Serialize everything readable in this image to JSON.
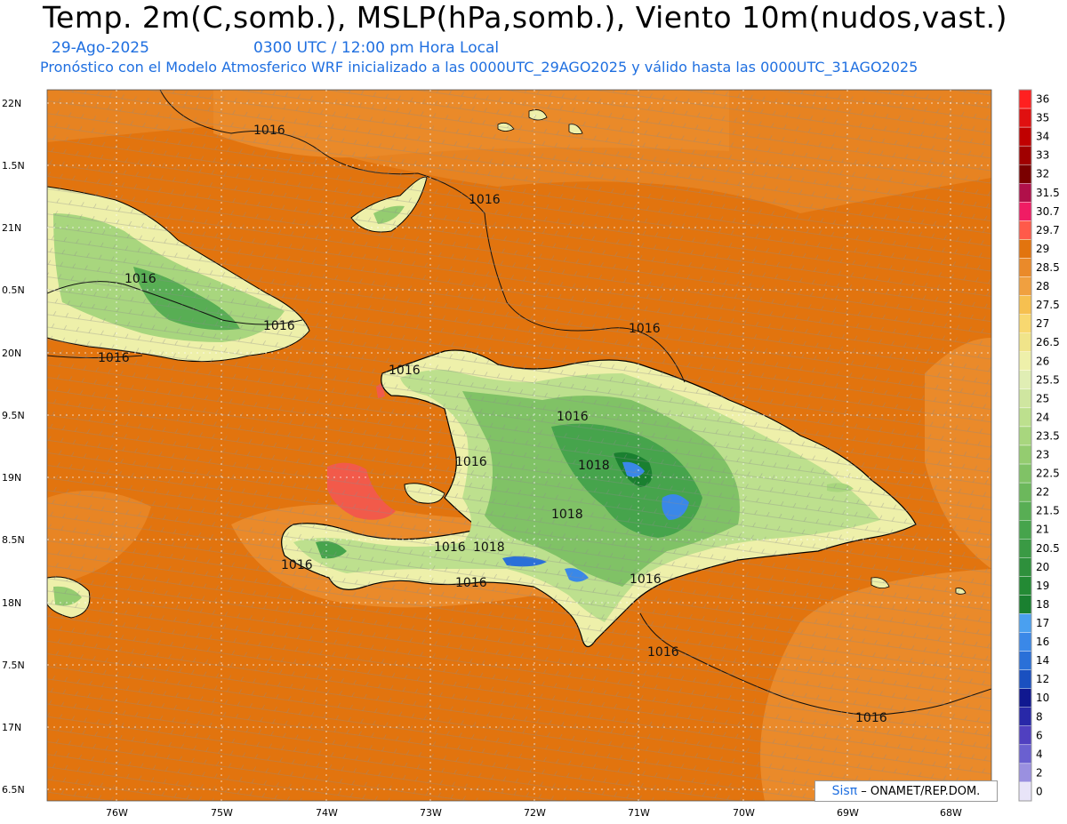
{
  "header": {
    "title": "Temp. 2m(C,somb.), MSLP(hPa,somb.), Viento 10m(nudos,vast.)",
    "date": "29-Ago-2025",
    "time": "0300 UTC / 12:00 pm Hora Local",
    "description": "Pronóstico con el Modelo Atmosferico WRF inicializado a las 0000UTC_29AGO2025 y válido hasta las  0000UTC_31AGO2025"
  },
  "axes": {
    "lat_labels": [
      "22N",
      "1.5N",
      "21N",
      "0.5N",
      "20N",
      "9.5N",
      "19N",
      "8.5N",
      "18N",
      "7.5N",
      "17N",
      "6.5N"
    ],
    "lon_labels": [
      "76W",
      "75W",
      "74W",
      "73W",
      "72W",
      "71W",
      "70W",
      "69W",
      "68W"
    ]
  },
  "isobars": {
    "labels": [
      "1016",
      "1016",
      "1016",
      "1016",
      "1016",
      "1016",
      "1016",
      "1016",
      "1016",
      "1018",
      "1018",
      "1016",
      "1018",
      "1016",
      "1016",
      "1016",
      "1016",
      "1016"
    ]
  },
  "legend": {
    "values": [
      "36",
      "35",
      "34",
      "33",
      "32",
      "31.5",
      "30.7",
      "29.7",
      "29",
      "28.5",
      "28",
      "27.5",
      "27",
      "26.5",
      "26",
      "25.5",
      "25",
      "24",
      "23.5",
      "23",
      "22.5",
      "22",
      "21.5",
      "21",
      "20.5",
      "20",
      "19",
      "18",
      "17",
      "16",
      "14",
      "12",
      "10",
      "8",
      "6",
      "4",
      "2",
      "0"
    ],
    "colors": [
      "#ff2020",
      "#e01010",
      "#c00000",
      "#a00000",
      "#7a0000",
      "#b0104a",
      "#f01c64",
      "#ff5a4a",
      "#e2740e",
      "#ea8a2a",
      "#f0a040",
      "#f6c050",
      "#f8d870",
      "#f0e48a",
      "#eef0aa",
      "#e0eeb4",
      "#cfe6a0",
      "#bde08e",
      "#a8d67e",
      "#94cc70",
      "#80c266",
      "#6cb85c",
      "#58ae54",
      "#46a44c",
      "#3a9a44",
      "#2e903c",
      "#238a34",
      "#1a8030",
      "#4aa0f0",
      "#3a88e8",
      "#2a70d8",
      "#1a50c0",
      "#101890",
      "#2828a8",
      "#5040c0",
      "#6a60d0",
      "#9a90e0",
      "#e8e4f8"
    ]
  },
  "credit": {
    "brand": "Sisπ",
    "org": "– ONAMET/REP.DOM."
  }
}
